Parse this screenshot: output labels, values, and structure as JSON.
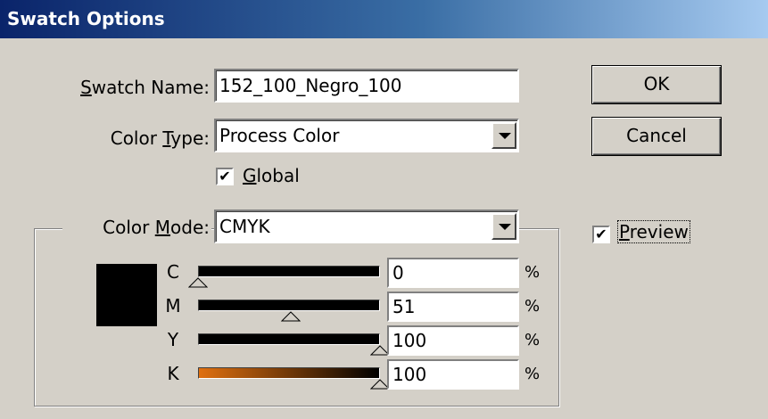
{
  "window": {
    "title": "Swatch Options"
  },
  "swatch_name": {
    "label_mnemonic": "S",
    "label_rest": "watch Name:",
    "value": "152_100_Negro_100"
  },
  "color_type": {
    "label_pre": "Color ",
    "label_mnemonic": "T",
    "label_rest": "ype:",
    "value": "Process Color"
  },
  "global": {
    "mnemonic": "G",
    "rest": "lobal",
    "checked": "✔"
  },
  "color_mode": {
    "label_pre": "Color ",
    "label_mnemonic": "M",
    "label_rest": "ode:",
    "value": "CMYK"
  },
  "buttons": {
    "ok": "OK",
    "cancel": "Cancel"
  },
  "preview": {
    "mnemonic": "P",
    "rest": "review",
    "checked": "✔"
  },
  "swatch_color": "#000000",
  "channels": [
    {
      "name": "C",
      "value": "0",
      "percent": 0,
      "unit": "%"
    },
    {
      "name": "M",
      "value": "51",
      "percent": 51,
      "unit": "%"
    },
    {
      "name": "Y",
      "value": "100",
      "percent": 100,
      "unit": "%"
    },
    {
      "name": "K",
      "value": "100",
      "percent": 100,
      "unit": "%"
    }
  ],
  "colors": {
    "k_bar_start": "#e07010",
    "k_bar_end": "#000000"
  }
}
